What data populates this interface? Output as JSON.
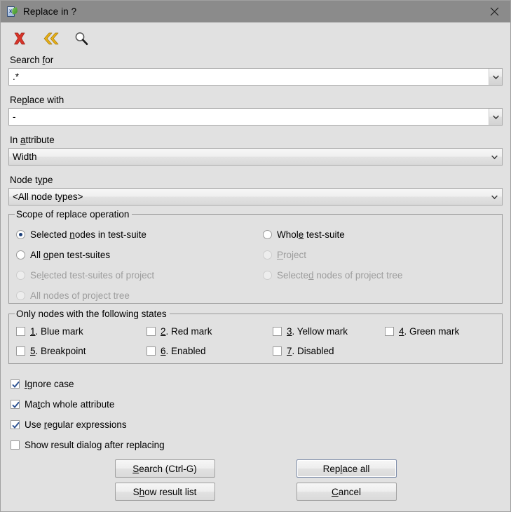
{
  "window": {
    "title": "Replace in ?",
    "icon": "document-leaf-icon",
    "close_label": "✕"
  },
  "toolbar": {
    "items": [
      {
        "name": "clear-icon",
        "label": "Clear"
      },
      {
        "name": "previous-icon",
        "label": "Previous"
      },
      {
        "name": "search-icon",
        "label": "Search"
      }
    ]
  },
  "fields": {
    "search_for": {
      "label_before": "Search ",
      "label_accel": "f",
      "label_after": "or",
      "value": ".*"
    },
    "replace_with": {
      "label_before": "Re",
      "label_accel": "p",
      "label_after": "lace with",
      "value": "-"
    },
    "in_attribute": {
      "label_before": "In ",
      "label_accel": "a",
      "label_after": "ttribute",
      "value": "Width"
    },
    "node_type": {
      "label_before": "Node t",
      "label_accel": "y",
      "label_after": "pe",
      "value": "<All node types>"
    }
  },
  "scope": {
    "legend": "Scope of replace operation",
    "options": [
      {
        "before": "Selected ",
        "accel": "n",
        "after": "odes in test-suite",
        "checked": true,
        "disabled": false
      },
      {
        "before": "Whol",
        "accel": "e",
        "after": " test-suite",
        "checked": false,
        "disabled": false
      },
      {
        "before": "All ",
        "accel": "o",
        "after": "pen test-suites",
        "checked": false,
        "disabled": false
      },
      {
        "before": "",
        "accel": "P",
        "after": "roject",
        "checked": false,
        "disabled": true
      },
      {
        "before": "Se",
        "accel": "l",
        "after": "ected test-suites of project",
        "checked": false,
        "disabled": true
      },
      {
        "before": "Selecte",
        "accel": "d",
        "after": " nodes of project tree",
        "checked": false,
        "disabled": true
      },
      {
        "before": "All nodes of project tree",
        "accel": "",
        "after": "",
        "checked": false,
        "disabled": true
      }
    ]
  },
  "states": {
    "legend": "Only nodes with the following states",
    "options": [
      {
        "before": "",
        "accel": "1",
        "after": ". Blue mark",
        "checked": false
      },
      {
        "before": "",
        "accel": "2",
        "after": ". Red mark",
        "checked": false
      },
      {
        "before": "",
        "accel": "3",
        "after": ". Yellow mark",
        "checked": false
      },
      {
        "before": "",
        "accel": "4",
        "after": ". Green mark",
        "checked": false
      },
      {
        "before": "",
        "accel": "5",
        "after": ". Breakpoint",
        "checked": false
      },
      {
        "before": "",
        "accel": "6",
        "after": ". Enabled",
        "checked": false
      },
      {
        "before": "",
        "accel": "7",
        "after": ". Disabled",
        "checked": false
      }
    ]
  },
  "options": [
    {
      "before": "",
      "accel": "I",
      "after": "gnore case",
      "checked": true
    },
    {
      "before": "Ma",
      "accel": "t",
      "after": "ch whole attribute",
      "checked": true
    },
    {
      "before": "Use ",
      "accel": "r",
      "after": "egular expressions",
      "checked": true
    },
    {
      "before": "Show result dialo",
      "accel": "g",
      "after": " after replacing",
      "checked": false
    }
  ],
  "buttons": {
    "search": {
      "before": "",
      "accel": "S",
      "after": "earch (Ctrl-G)",
      "default": false
    },
    "replace_all": {
      "before": "Rep",
      "accel": "l",
      "after": "ace all",
      "default": true
    },
    "show_result": {
      "before": "S",
      "accel": "h",
      "after": "ow result list",
      "default": false
    },
    "cancel": {
      "before": "",
      "accel": "C",
      "after": "ancel",
      "default": false
    }
  },
  "colors": {
    "titlebar": "#8b8b8b",
    "dialog_bg": "#e1e1e1",
    "accent_check": "#1b3f7a",
    "toolbar_clear": "#d33b2c",
    "toolbar_prev": "#e0a21a"
  }
}
